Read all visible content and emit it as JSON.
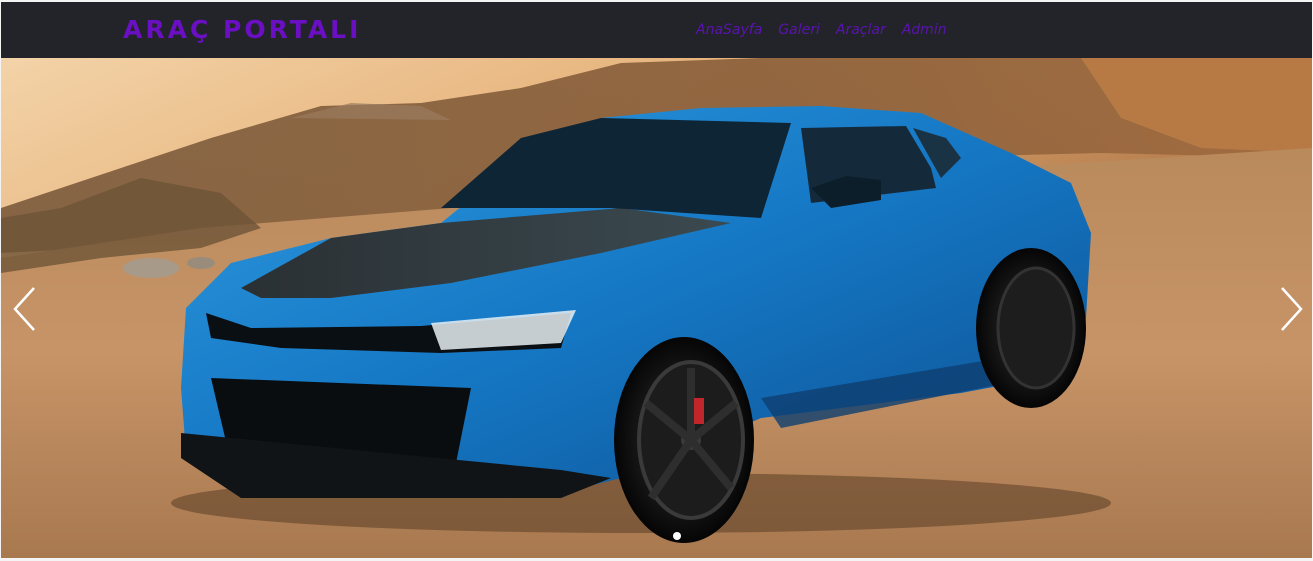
{
  "navbar": {
    "brand": "ARAÇ PORTALI",
    "links": [
      {
        "label": "AnaSayfa"
      },
      {
        "label": "Galeri"
      },
      {
        "label": "Araçlar"
      },
      {
        "label": "Admin"
      }
    ]
  },
  "carousel": {
    "slide_count": 1,
    "active_index": 0,
    "prev_icon": "chevron-left-icon",
    "next_icon": "chevron-right-icon"
  },
  "colors": {
    "navbar_bg": "#232429",
    "brand": "#6a0fc4",
    "nav_link": "#5a13b0",
    "car_body": "#1f7fc8"
  }
}
